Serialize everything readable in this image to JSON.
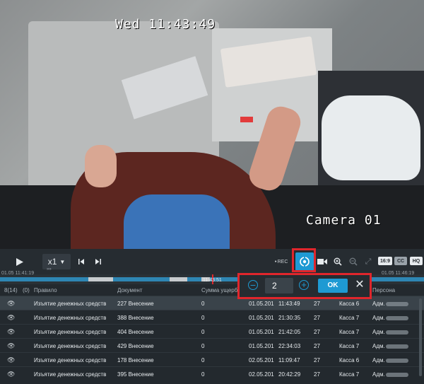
{
  "video": {
    "timestamp": "Wed 11:43:49",
    "camera_label": "Camera 01"
  },
  "toolbar": {
    "play_icon": "play-icon",
    "speed_label": "x1",
    "speed_sub": "»»",
    "rec_label": "REC",
    "badge_169": "16:9",
    "badge_cc": "CC",
    "badge_hq": "HQ"
  },
  "timeline": {
    "start": "01.05 11:41:19",
    "center": "11:43:51",
    "end": "01.05 11:46:19"
  },
  "table": {
    "headers": {
      "count": "8(14)",
      "zero": "(0)",
      "rule": "Правило",
      "document": "Документ",
      "damage": "Сумма ущерба",
      "person": "Персона"
    },
    "rows": [
      {
        "rule": "Изъятие денежных средств",
        "document": "227 Внесение",
        "damage": "0",
        "date": "01.05.201",
        "time": "11:43:49",
        "num": "27",
        "kassa": "Касса 6",
        "person": "Адм."
      },
      {
        "rule": "Изъятие денежных средств",
        "document": "388 Внесение",
        "damage": "0",
        "date": "01.05.201",
        "time": "21:30:35",
        "num": "27",
        "kassa": "Касса 7",
        "person": "Адм."
      },
      {
        "rule": "Изъятие денежных средств",
        "document": "404 Внесение",
        "damage": "0",
        "date": "01.05.201",
        "time": "21:42:05",
        "num": "27",
        "kassa": "Касса 7",
        "person": "Адм."
      },
      {
        "rule": "Изъятие денежных средств",
        "document": "429 Внесение",
        "damage": "0",
        "date": "01.05.201",
        "time": "22:34:03",
        "num": "27",
        "kassa": "Касса 7",
        "person": "Адм."
      },
      {
        "rule": "Изъятие денежных средств",
        "document": "178 Внесение",
        "damage": "0",
        "date": "02.05.201",
        "time": "11:09:47",
        "num": "27",
        "kassa": "Касса 6",
        "person": "Адм."
      },
      {
        "rule": "Изъятие денежных средств",
        "document": "395 Внесение",
        "damage": "0",
        "date": "02.05.201",
        "time": "20:42:29",
        "num": "27",
        "kassa": "Касса 7",
        "person": "Адм."
      }
    ]
  },
  "popup": {
    "value": "2",
    "ok_label": "OK",
    "close_label": "✕"
  },
  "colors": {
    "accent": "#1e9ad3",
    "highlight": "#e0262c",
    "background": "#23292e"
  }
}
